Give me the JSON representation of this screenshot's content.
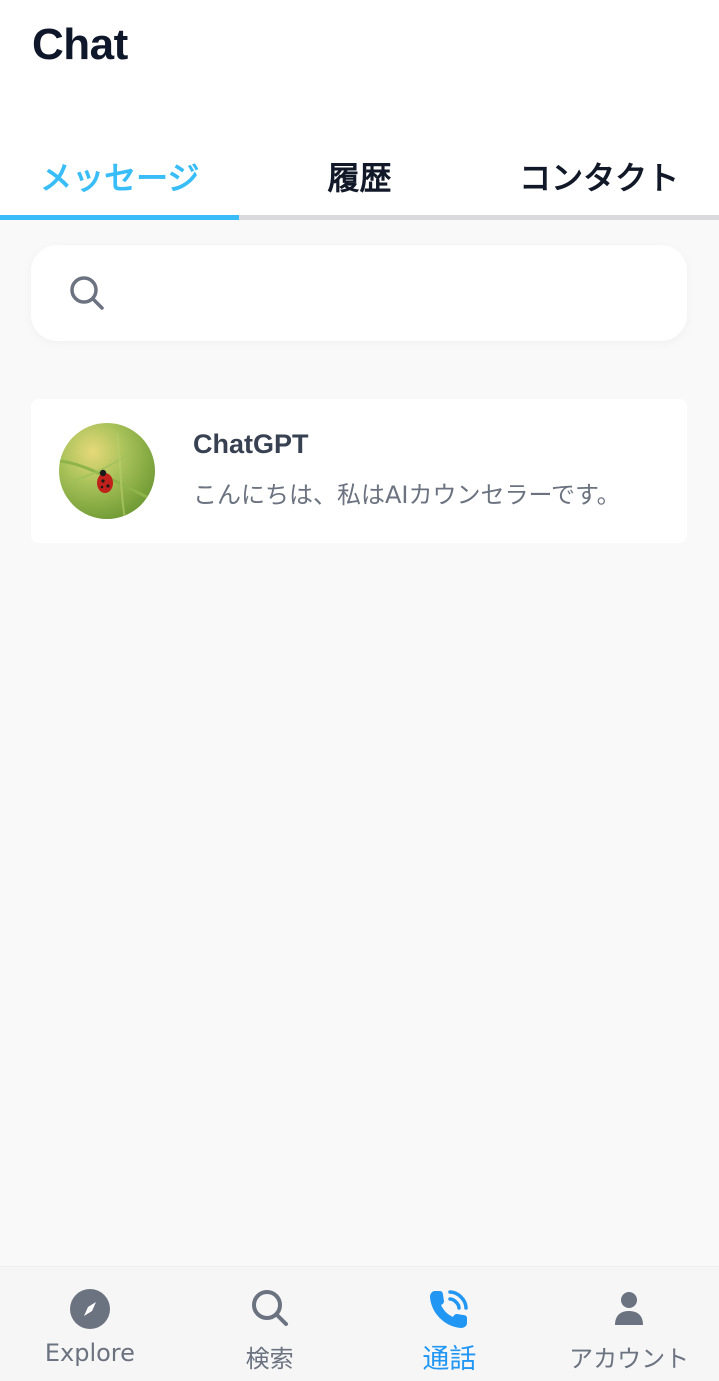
{
  "header": {
    "title": "Chat"
  },
  "tabs": [
    {
      "label": "メッセージ",
      "active": true
    },
    {
      "label": "履歴",
      "active": false
    },
    {
      "label": "コンタクト",
      "active": false
    }
  ],
  "search": {
    "placeholder": ""
  },
  "chats": [
    {
      "name": "ChatGPT",
      "preview": "こんにちは、私はAIカウンセラーです。",
      "avatar_icon": "ladybug-photo"
    }
  ],
  "bottom_nav": [
    {
      "label": "Explore",
      "icon": "compass-icon",
      "active": false
    },
    {
      "label": "検索",
      "icon": "search-icon",
      "active": false
    },
    {
      "label": "通話",
      "icon": "phone-call-icon",
      "active": true
    },
    {
      "label": "アカウント",
      "icon": "user-icon",
      "active": false
    }
  ],
  "colors": {
    "accent": "#38bdf8",
    "nav_active": "#2196f3",
    "muted": "#6b7280",
    "title": "#0f172a"
  }
}
